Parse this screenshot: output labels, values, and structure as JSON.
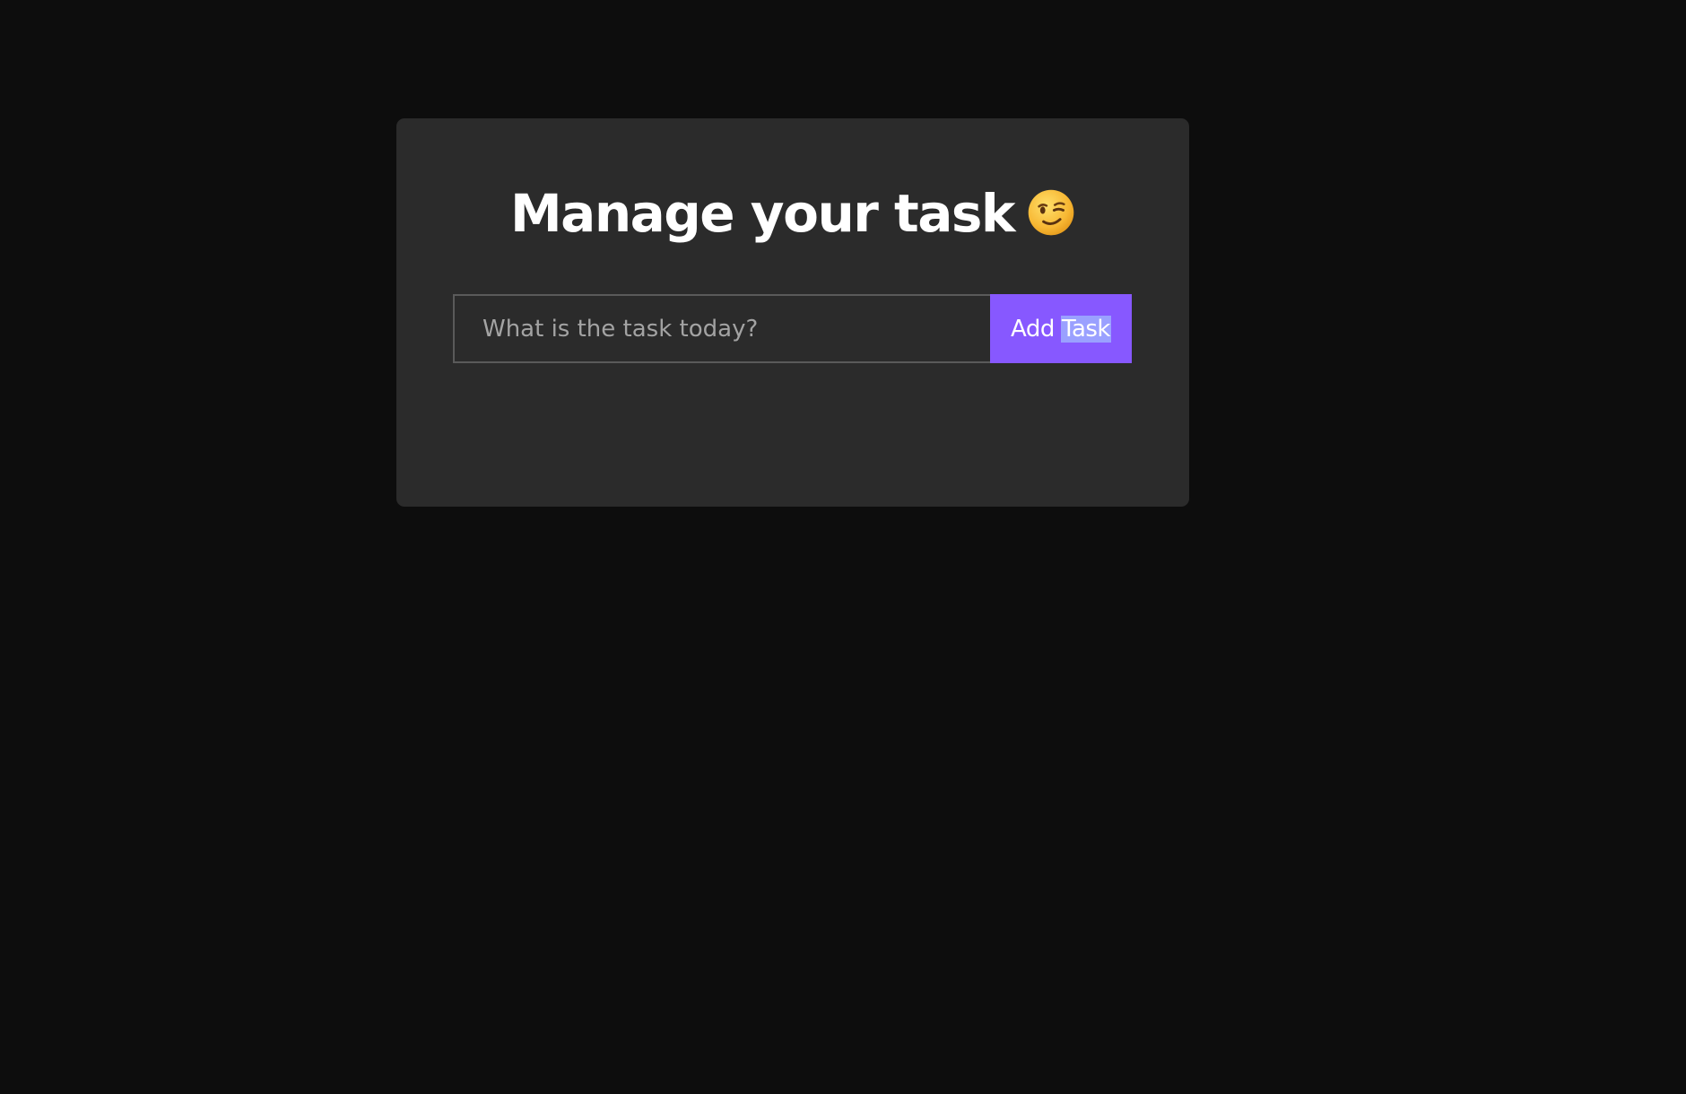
{
  "card": {
    "title": "Manage your task",
    "title_emoji_icon": "winking-face-icon"
  },
  "task_form": {
    "input_placeholder": "What is the task today?",
    "input_value": "",
    "button_label_part1": "Add",
    "button_label_part2_selected": "Task"
  },
  "colors": {
    "page_background": "#0d0d0d",
    "card_background": "#2b2b2b",
    "accent": "#8758ff",
    "text_selection": "#9aa0ff"
  }
}
